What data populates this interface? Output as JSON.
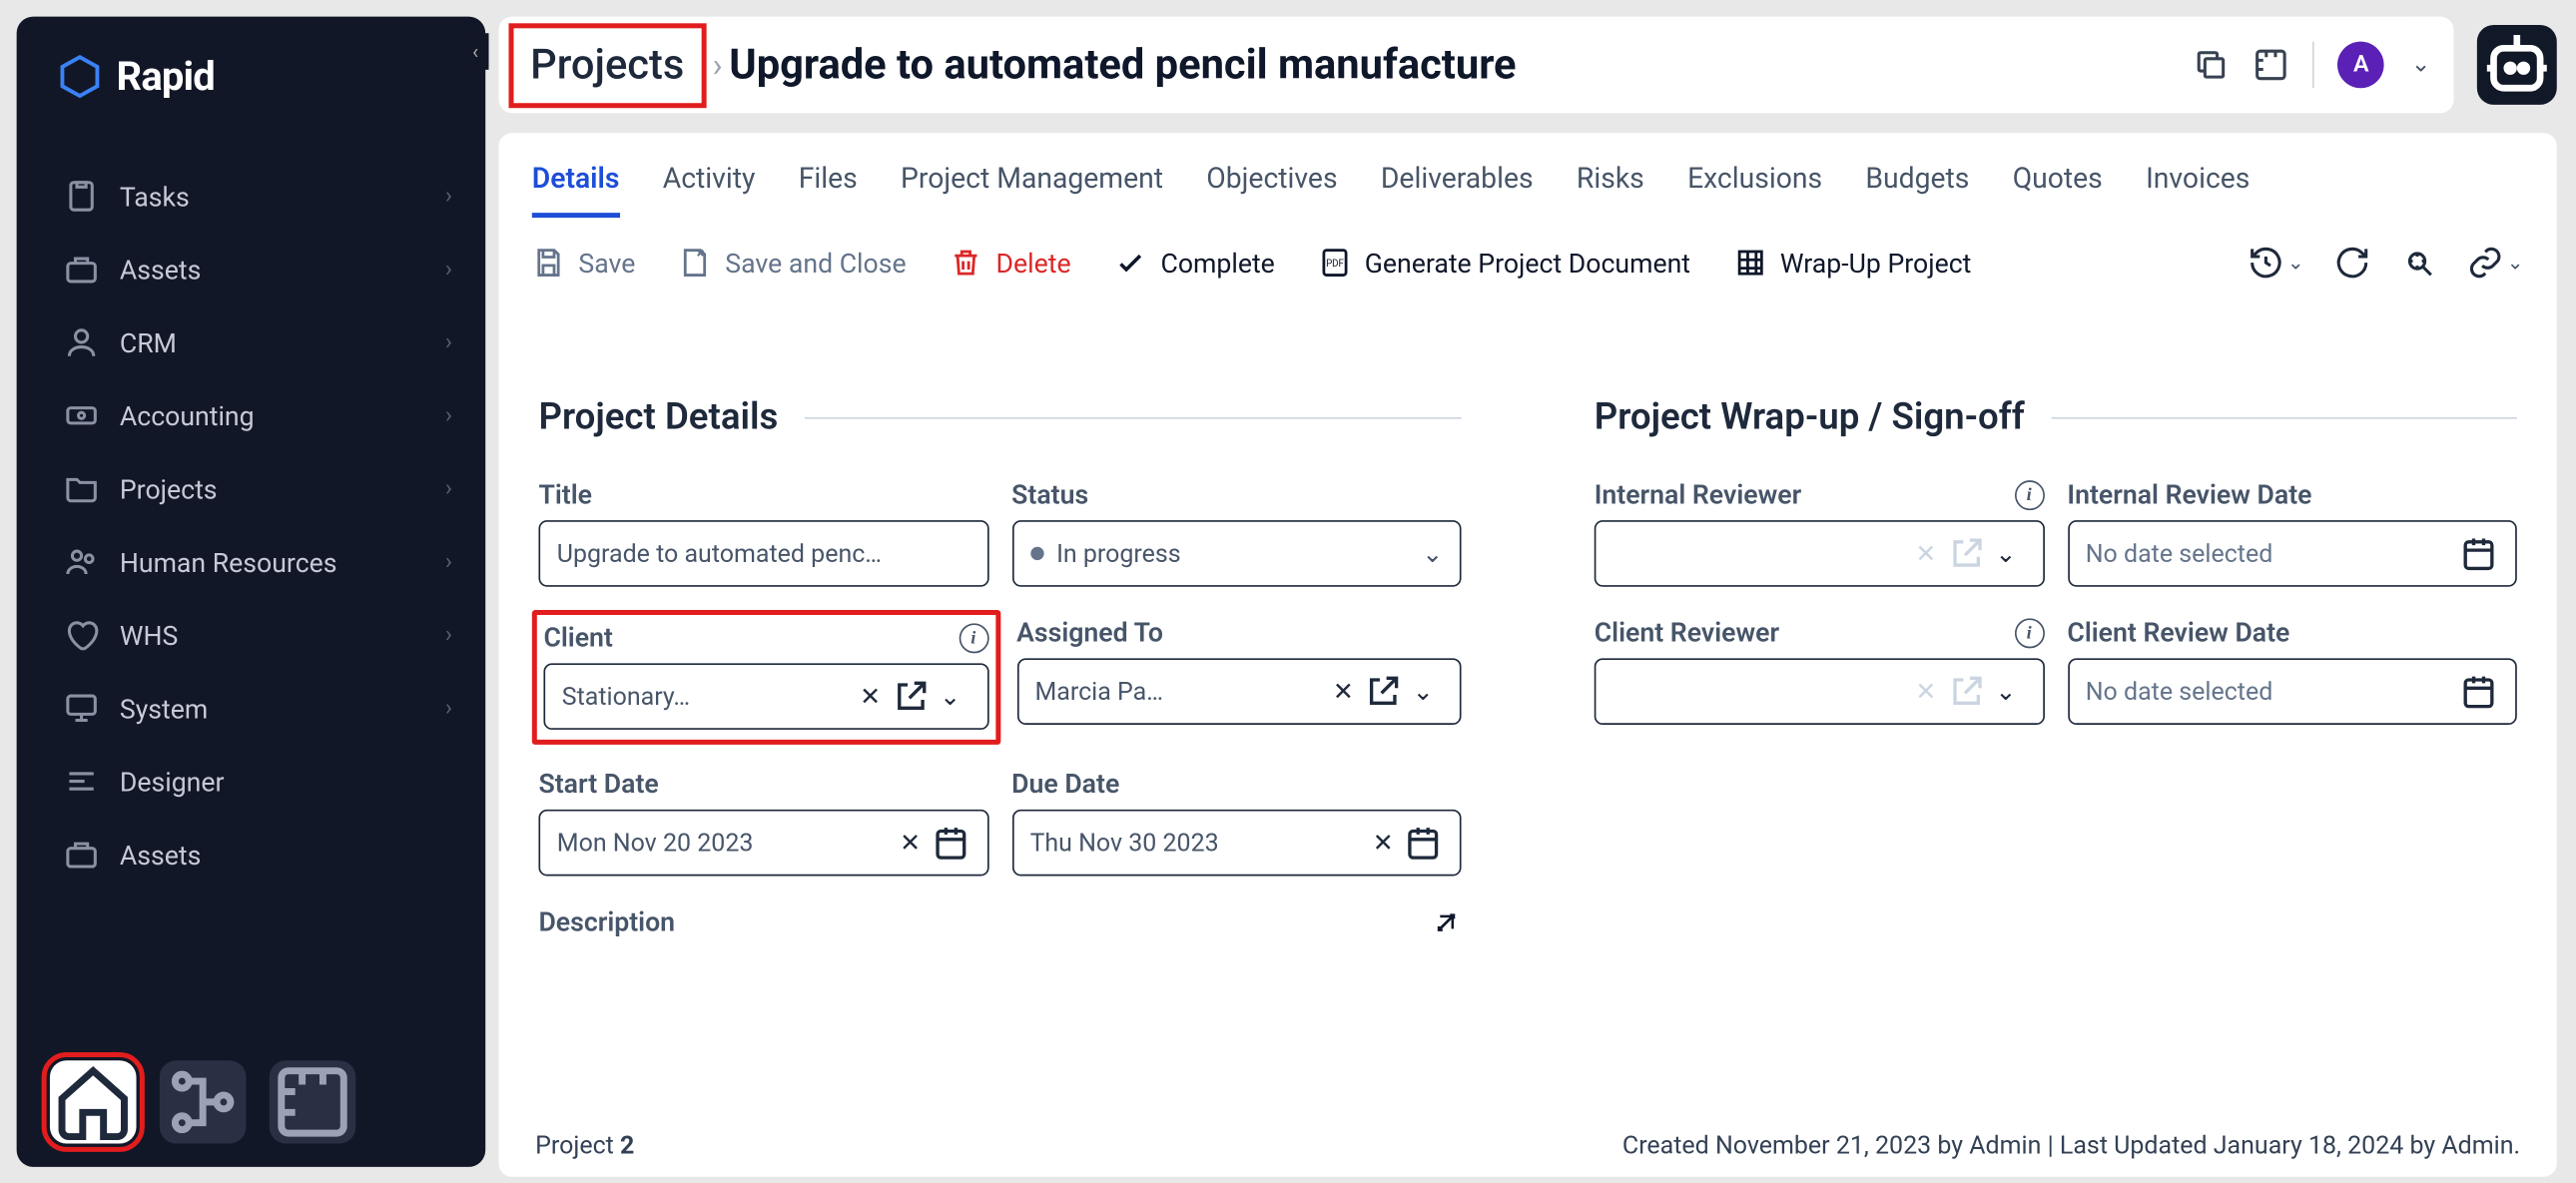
{
  "brand": {
    "name": "Rapid"
  },
  "sidebar": {
    "items": [
      {
        "label": "Tasks"
      },
      {
        "label": "Assets"
      },
      {
        "label": "CRM"
      },
      {
        "label": "Accounting"
      },
      {
        "label": "Projects"
      },
      {
        "label": "Human Resources"
      },
      {
        "label": "WHS"
      },
      {
        "label": "System"
      },
      {
        "label": "Designer"
      },
      {
        "label": "Assets"
      }
    ]
  },
  "breadcrumb": {
    "root": "Projects",
    "title": "Upgrade to automated pencil manufacture"
  },
  "user": {
    "initial": "A"
  },
  "tabs": [
    "Details",
    "Activity",
    "Files",
    "Project Management",
    "Objectives",
    "Deliverables",
    "Risks",
    "Exclusions",
    "Budgets",
    "Quotes",
    "Invoices"
  ],
  "active_tab": "Details",
  "toolbar": {
    "save": "Save",
    "save_close": "Save and Close",
    "delete": "Delete",
    "complete": "Complete",
    "generate": "Generate Project Document",
    "wrapup": "Wrap-Up Project"
  },
  "sections": {
    "details_title": "Project Details",
    "wrapup_title": "Project Wrap-up / Sign-off"
  },
  "fields": {
    "title_label": "Title",
    "title_value": "Upgrade to automated penc…",
    "status_label": "Status",
    "status_value": "In progress",
    "client_label": "Client",
    "client_value": "Stationary…",
    "assigned_label": "Assigned To",
    "assigned_value": "Marcia Pa…",
    "start_label": "Start Date",
    "start_value": "Mon Nov 20 2023",
    "due_label": "Due Date",
    "due_value": "Thu Nov 30 2023",
    "description_label": "Description",
    "int_reviewer_label": "Internal Reviewer",
    "int_reviewer_value": "",
    "int_date_label": "Internal Review Date",
    "int_date_value": "No date selected",
    "cli_reviewer_label": "Client Reviewer",
    "cli_reviewer_value": "",
    "cli_date_label": "Client Review Date",
    "cli_date_value": "No date selected"
  },
  "footer": {
    "project_label": "Project",
    "project_id": "2",
    "meta": "Created November 21, 2023 by Admin | Last Updated January 18, 2024 by Admin."
  }
}
